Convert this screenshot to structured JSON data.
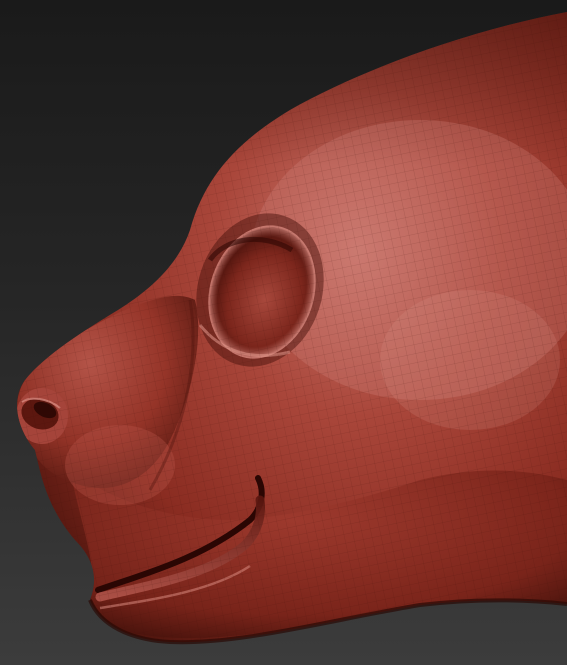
{
  "scene": {
    "subject": "",
    "background_color": "#2b2b2b",
    "material_base_color": "#9a3328",
    "material_highlight_color": "#c76a60",
    "material_shadow_color": "#3a0d08"
  }
}
